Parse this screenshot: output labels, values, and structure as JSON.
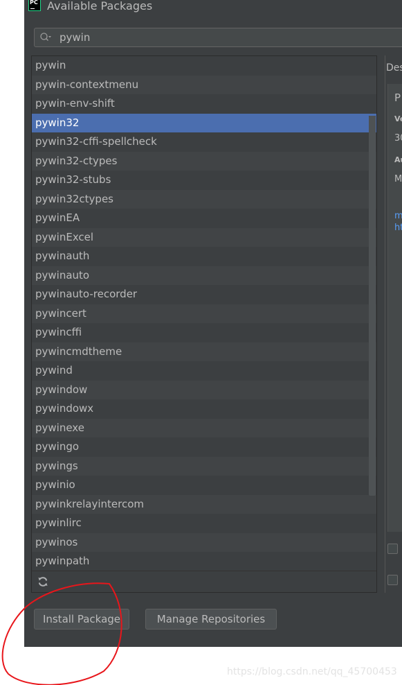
{
  "window": {
    "title": "Available Packages",
    "app_icon": "pycharm-icon"
  },
  "search": {
    "value": "pywin",
    "icon": "search-icon"
  },
  "packages": [
    "pywin",
    "pywin-contextmenu",
    "pywin-env-shift",
    "pywin32",
    "pywin32-cffi-spellcheck",
    "pywin32-ctypes",
    "pywin32-stubs",
    "pywin32ctypes",
    "pywinEA",
    "pywinExcel",
    "pywinauth",
    "pywinauto",
    "pywinauto-recorder",
    "pywincert",
    "pywincffi",
    "pywincmdtheme",
    "pywind",
    "pywindow",
    "pywindowx",
    "pywinexe",
    "pywingo",
    "pywings",
    "pywinio",
    "pywinkrelayintercom",
    "pywinlirc",
    "pywinos",
    "pywinpath"
  ],
  "selected_package": "pywin32",
  "list_toolbar": {
    "refresh_icon": "refresh-icon"
  },
  "description": {
    "tab_label": "Des",
    "lines": [
      "P",
      "Ve",
      "30",
      "Au",
      "M"
    ],
    "links": [
      "m",
      "ht"
    ]
  },
  "buttons": {
    "install": "Install Package",
    "manage": "Manage Repositories"
  },
  "watermark": "https://blog.csdn.net/qq_45700453",
  "colors": {
    "background": "#3c3f41",
    "selection": "#4b6eaf",
    "annotation": "#e8161b",
    "link": "#589df6"
  }
}
